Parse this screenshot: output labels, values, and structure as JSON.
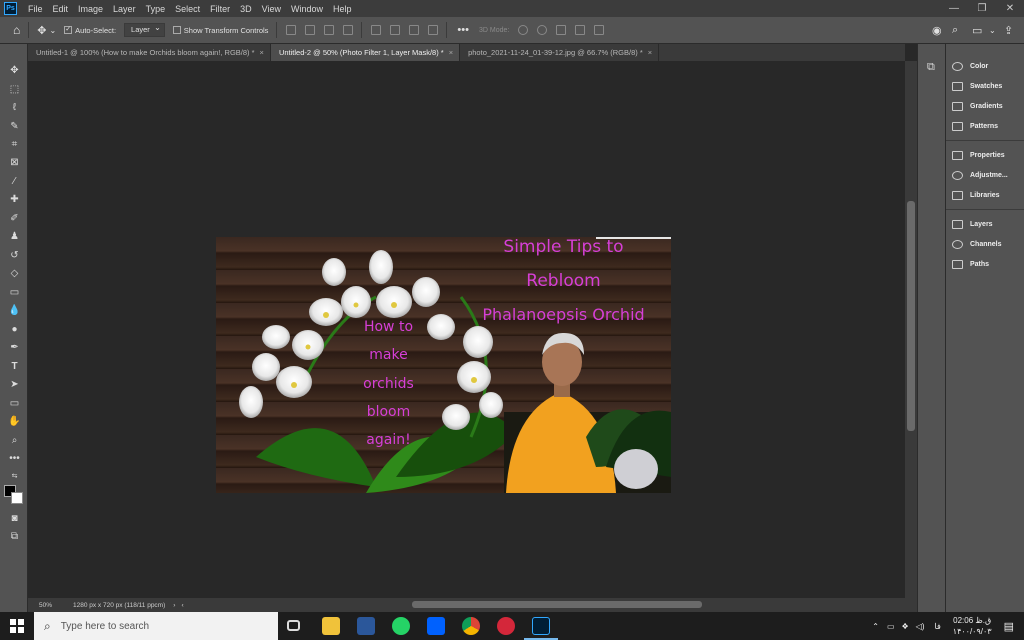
{
  "menubar": {
    "items": [
      "File",
      "Edit",
      "Image",
      "Layer",
      "Type",
      "Select",
      "Filter",
      "3D",
      "View",
      "Window",
      "Help"
    ]
  },
  "options": {
    "auto_select_label": "Auto-Select:",
    "auto_select_value": "Layer",
    "show_transform_label": "Show Transform Controls",
    "mode_3d_label": "3D Mode:"
  },
  "tabs": [
    {
      "label": "Untitled-1 @ 100% (How to make Orchids bloom again!, RGB/8) *",
      "active": false
    },
    {
      "label": "Untitled-2 @ 50% (Photo Filter 1, Layer Mask/8) *",
      "active": true
    },
    {
      "label": "photo_2021-11-24_01-39-12.jpg @ 66.7% (RGB/8) *",
      "active": false
    }
  ],
  "canvas_texts": {
    "title_line1": "Simple Tips to",
    "title_line2": "Rebloom",
    "title_line3": "Phalanoepsis Orchid",
    "side_line1": "How to",
    "side_line2": "make",
    "side_line3": "orchids",
    "side_line4": "bloom",
    "side_line5": "again!"
  },
  "status": {
    "zoom": "50%",
    "doc_size": "1280 px x 720 px (118/11 ppcm)"
  },
  "panels": {
    "group1": [
      "Color",
      "Swatches",
      "Gradients",
      "Patterns"
    ],
    "group2": [
      "Properties",
      "Adjustme...",
      "Libraries"
    ],
    "group3": [
      "Layers",
      "Channels",
      "Paths"
    ]
  },
  "taskbar": {
    "search_placeholder": "Type here to search",
    "lang": "فا",
    "time": "02:06 ق.ظ",
    "date": "۱۴۰۰/۰۹/۰۳"
  },
  "colors": {
    "accent_text": "#d63fd6",
    "ps_blue": "#31a8ff"
  }
}
